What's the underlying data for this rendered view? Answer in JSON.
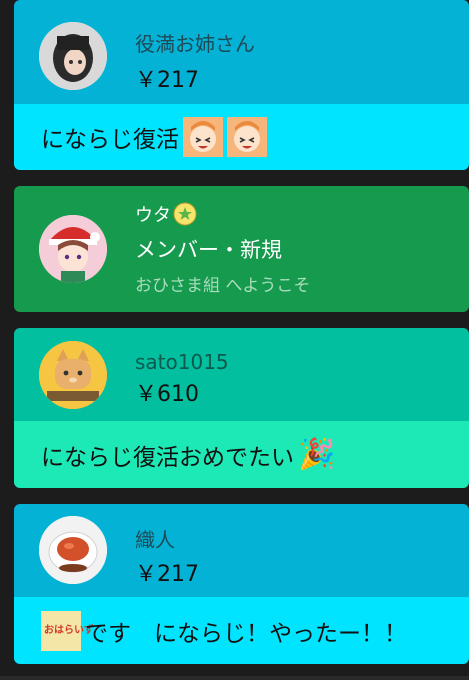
{
  "colors": {
    "background": "#1c1c1c",
    "superchat_blue_head": "#03b2d5",
    "superchat_blue_body": "#00e4ff",
    "member_green": "#169a4e",
    "superchat_teal_head": "#02bf9f",
    "superchat_teal_body": "#1de9b6"
  },
  "chat": [
    {
      "name": "役満お姉さん",
      "amount": "￥217",
      "message": "にならじ復活",
      "stamps": [
        "laughing-girl-stamp",
        "laughing-girl-stamp"
      ]
    },
    {
      "name": "ウタ",
      "badge": "member-badge-icon",
      "title": "メンバー・新規",
      "subtitle": "おひさま組 へようこそ"
    },
    {
      "name": "sato1015",
      "amount": "￥610",
      "message": "にならじ復活おめでたい",
      "emoji": "🎉"
    },
    {
      "name": "織人",
      "amount": "￥217",
      "message_prefix_stamp_text": "おはらいず",
      "message": "です　にならじ！やったー！！"
    }
  ]
}
